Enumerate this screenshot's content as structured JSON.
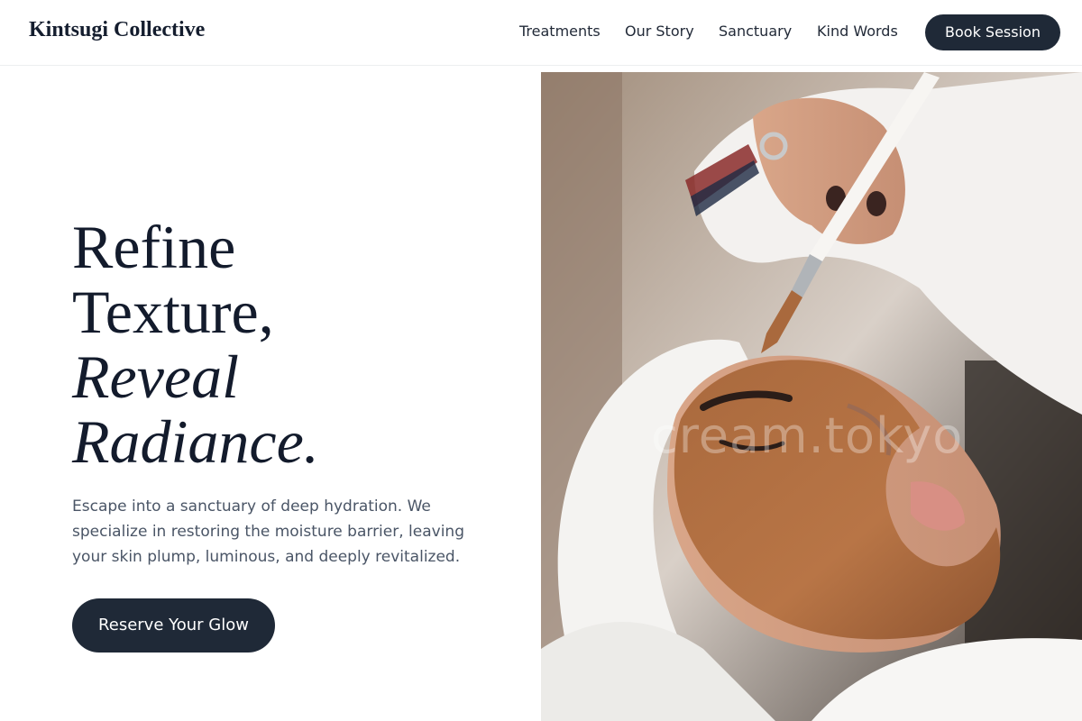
{
  "brand": {
    "name": "Kintsugi Collective"
  },
  "nav": {
    "items": [
      {
        "label": "Treatments"
      },
      {
        "label": "Our Story"
      },
      {
        "label": "Sanctuary"
      },
      {
        "label": "Kind Words"
      }
    ],
    "book_label": "Book Session"
  },
  "hero": {
    "headline": {
      "line1": "Refine",
      "line2": "Texture,",
      "line3": "Reveal",
      "line4": "Radiance."
    },
    "description": "Escape into a sanctuary of deep hydration. We specialize in restoring the moisture barrier, leaving your skin plump, luminous, and deeply revitalized.",
    "cta_label": "Reserve Your Glow"
  },
  "photo": {
    "watermark": "cream.tokyo"
  },
  "colors": {
    "primary_dark": "#1f2937",
    "text_dark": "#131b2c",
    "text_muted": "#4a5566",
    "divider": "#eceef0"
  }
}
